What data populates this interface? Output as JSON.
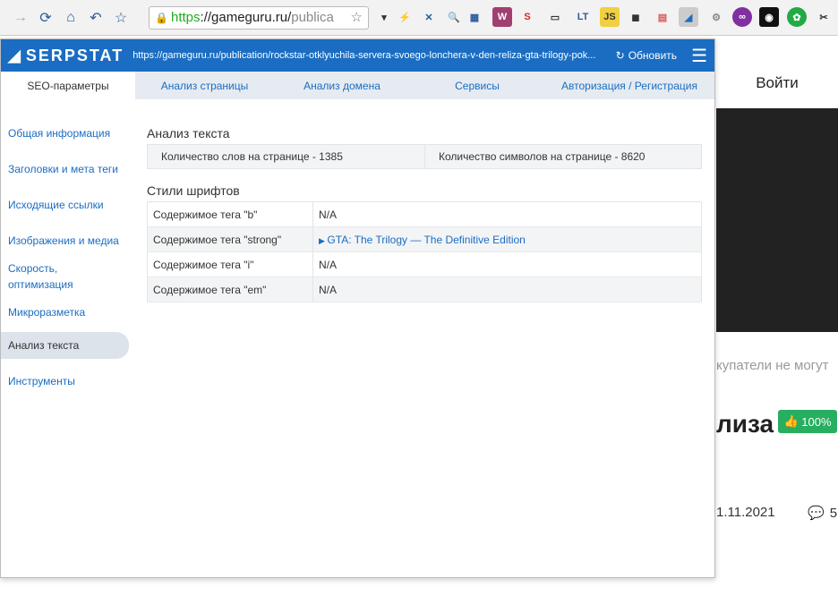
{
  "browser": {
    "url_proto": "https",
    "url_host": "://gameguru.ru/",
    "url_rest": "publica"
  },
  "popup": {
    "logo": "SERPSTAT",
    "url": "https://gameguru.ru/publication/rockstar-otklyuchila-servera-svoego-lonchera-v-den-reliza-gta-trilogy-pok...",
    "refresh_label": "Обновить",
    "tabs": [
      "SEO-параметры",
      "Анализ страницы",
      "Анализ домена",
      "Сервисы",
      "Авторизация / Регистрация"
    ],
    "sidebar": [
      "Общая информация",
      "Заголовки и мета теги",
      "Исходящие ссылки",
      "Изображения и медиа",
      "Скорость, оптимизация",
      "Микроразметка",
      "Анализ текста",
      "Инструменты"
    ],
    "text_analysis": {
      "title": "Анализ текста",
      "words": "Количество слов на странице - 1385",
      "chars": "Количество символов на странице - 8620"
    },
    "font_styles": {
      "title": "Стили шрифтов",
      "rows": [
        {
          "label": "Содержимое тега \"b\"",
          "value": "N/A"
        },
        {
          "label": "Содержимое тега \"strong\"",
          "value": "GTA: The Trilogy — The Definitive Edition"
        },
        {
          "label": "Содержимое тега \"i\"",
          "value": "N/A"
        },
        {
          "label": "Содержимое тега \"em\"",
          "value": "N/A"
        }
      ]
    }
  },
  "page": {
    "login": "Войти",
    "subtitle": "купатели не могут",
    "title": "лиза",
    "rating": "100%",
    "date": "1.11.2021",
    "comments": "5"
  },
  "colors": {
    "accent": "#1a6dc2",
    "badge": "#27ae60"
  }
}
